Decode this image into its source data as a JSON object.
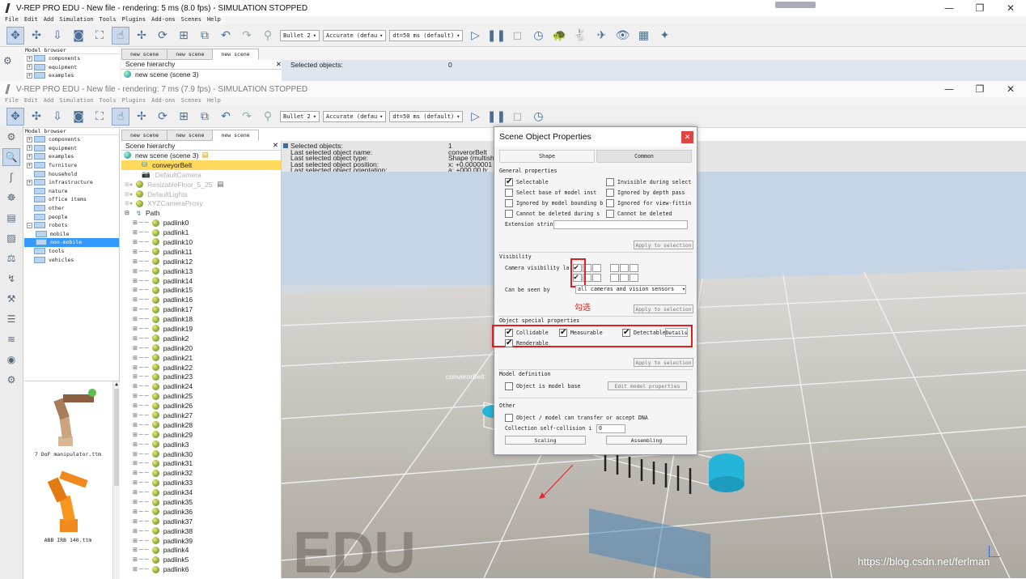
{
  "window1": {
    "title": "V-REP PRO EDU - New file - rendering: 5 ms (8.0 fps) - SIMULATION STOPPED",
    "menu": [
      "File",
      "Edit",
      "Add",
      "Simulation",
      "Tools",
      "Plugins",
      "Add-ons",
      "Scenes",
      "Help"
    ],
    "controls": {
      "minimize": "—",
      "restore": "❐",
      "close": "✕"
    },
    "tabs": [
      "new scene",
      "new scene",
      "new scene"
    ],
    "model_browser_title": "Model browser",
    "model_items": [
      "components",
      "equipment",
      "examples"
    ],
    "hierarchy_header": "Scene hierarchy",
    "hierarchy_root": "new scene (scene 3)",
    "selected_objects_label": "Selected objects:",
    "selected_objects_value": "0"
  },
  "window2": {
    "title": "V-REP PRO EDU - New file - rendering: 7 ms (7.9 fps) - SIMULATION STOPPED",
    "menu": [
      "File",
      "Edit",
      "Add",
      "Simulation",
      "Tools",
      "Plugins",
      "Add-ons",
      "Scenes",
      "Help"
    ],
    "controls": {
      "minimize": "—",
      "restore": "❐",
      "close": "✕"
    }
  },
  "toolbar": {
    "engine": "Bullet 2",
    "accuracy": "Accurate (defau",
    "dt": "dt=50 ms (default)"
  },
  "model_browser": {
    "title": "Model browser",
    "items": [
      {
        "label": "components",
        "expand": "+"
      },
      {
        "label": "equipment",
        "expand": "+"
      },
      {
        "label": "examples",
        "expand": "+"
      },
      {
        "label": "furniture",
        "expand": "+"
      },
      {
        "label": "household",
        "expand": ""
      },
      {
        "label": "infrastructure",
        "expand": "+"
      },
      {
        "label": "nature",
        "expand": ""
      },
      {
        "label": "office items",
        "expand": ""
      },
      {
        "label": "other",
        "expand": ""
      },
      {
        "label": "people",
        "expand": ""
      },
      {
        "label": "robots",
        "expand": "−"
      },
      {
        "label": "mobile",
        "expand": ""
      },
      {
        "label": "non-mobile",
        "expand": ""
      },
      {
        "label": "tools",
        "expand": ""
      },
      {
        "label": "vehicles",
        "expand": ""
      }
    ],
    "thumbnails": [
      "7 DoF manipulator.ttm",
      "ABB IRB 140.ttm"
    ]
  },
  "scene_tabs": [
    "new scene",
    "new scene",
    "new scene"
  ],
  "hierarchy": {
    "header": "Scene hierarchy",
    "root": "new scene (scene 3)",
    "selected": "conveyorBelt",
    "objects": [
      "DefaultCamera",
      "ResizableFloor_5_25",
      "DefaultLights",
      "XYZCameraProxy",
      "Path"
    ],
    "padlinks": [
      "padlink0",
      "padlink1",
      "padlink10",
      "padlink11",
      "padlink12",
      "padlink13",
      "padlink14",
      "padlink15",
      "padlink16",
      "padlink17",
      "padlink18",
      "padlink19",
      "padlink2",
      "padlink20",
      "padlink21",
      "padlink22",
      "padlink23",
      "padlink24",
      "padlink25",
      "padlink26",
      "padlink27",
      "padlink28",
      "padlink29",
      "padlink3",
      "padlink30",
      "padlink31",
      "padlink32",
      "padlink33",
      "padlink34",
      "padlink35",
      "padlink36",
      "padlink37",
      "padlink38",
      "padlink39",
      "padlink4",
      "padlink5",
      "padlink6"
    ]
  },
  "selection_info": {
    "labels": [
      "Selected objects:",
      "Last selected object name:",
      "Last selected object type:",
      "Last selected object position:",
      "Last selected object orientation:"
    ],
    "values": [
      "1",
      "converorBelt",
      "Shape (multish",
      "x: +0.0000001",
      "a: +000.00   b:"
    ]
  },
  "scene": {
    "label": "converorBelt",
    "watermark": "EDU",
    "credit": "https://blog.csdn.net/ferlman"
  },
  "dialog": {
    "title": "Scene Object Properties",
    "close": "✕",
    "tabs": [
      "Shape",
      "Common"
    ],
    "general_header": "General properties",
    "general": {
      "selectable": "Selectable",
      "invisible": "Invisible during select",
      "select_base": "Select base of model inst",
      "ignored_depth": "Ignored by depth pass",
      "ignored_bounding": "Ignored by model bounding  b",
      "ignored_view": "Ignored for view-fittin",
      "cannot_deleted_sim": "Cannot be deleted during s",
      "cannot_deleted": "Cannot be deleted",
      "extension": "Extension strin"
    },
    "apply": "Apply to selection",
    "visibility_header": "Visibility",
    "camera_layers": "Camera visibility la",
    "can_be_seen": "Can be seen by",
    "seen_value": "all cameras and vision sensors",
    "annotation": "勾选",
    "special_header": "Object special properties",
    "special": {
      "collidable": "Collidable",
      "measurable": "Measurable",
      "detectable": "Detectable",
      "details": "Details",
      "renderable": "Renderable"
    },
    "model_header": "Model definition",
    "is_model_base": "Object is model base",
    "edit_model": "Edit model properties",
    "other_header": "Other",
    "dna": "Object / model can transfer or accept DNA",
    "self_collision": "Collection self-collision i",
    "self_collision_value": "0",
    "scaling": "Scaling",
    "assembling": "Assembling",
    "check": "✔"
  },
  "colors": {
    "annotation_red": "#e02020",
    "selection_blue": "#3399ff",
    "selection_yellow": "#ffd95c",
    "belt_cyan": "#25b5d8"
  }
}
